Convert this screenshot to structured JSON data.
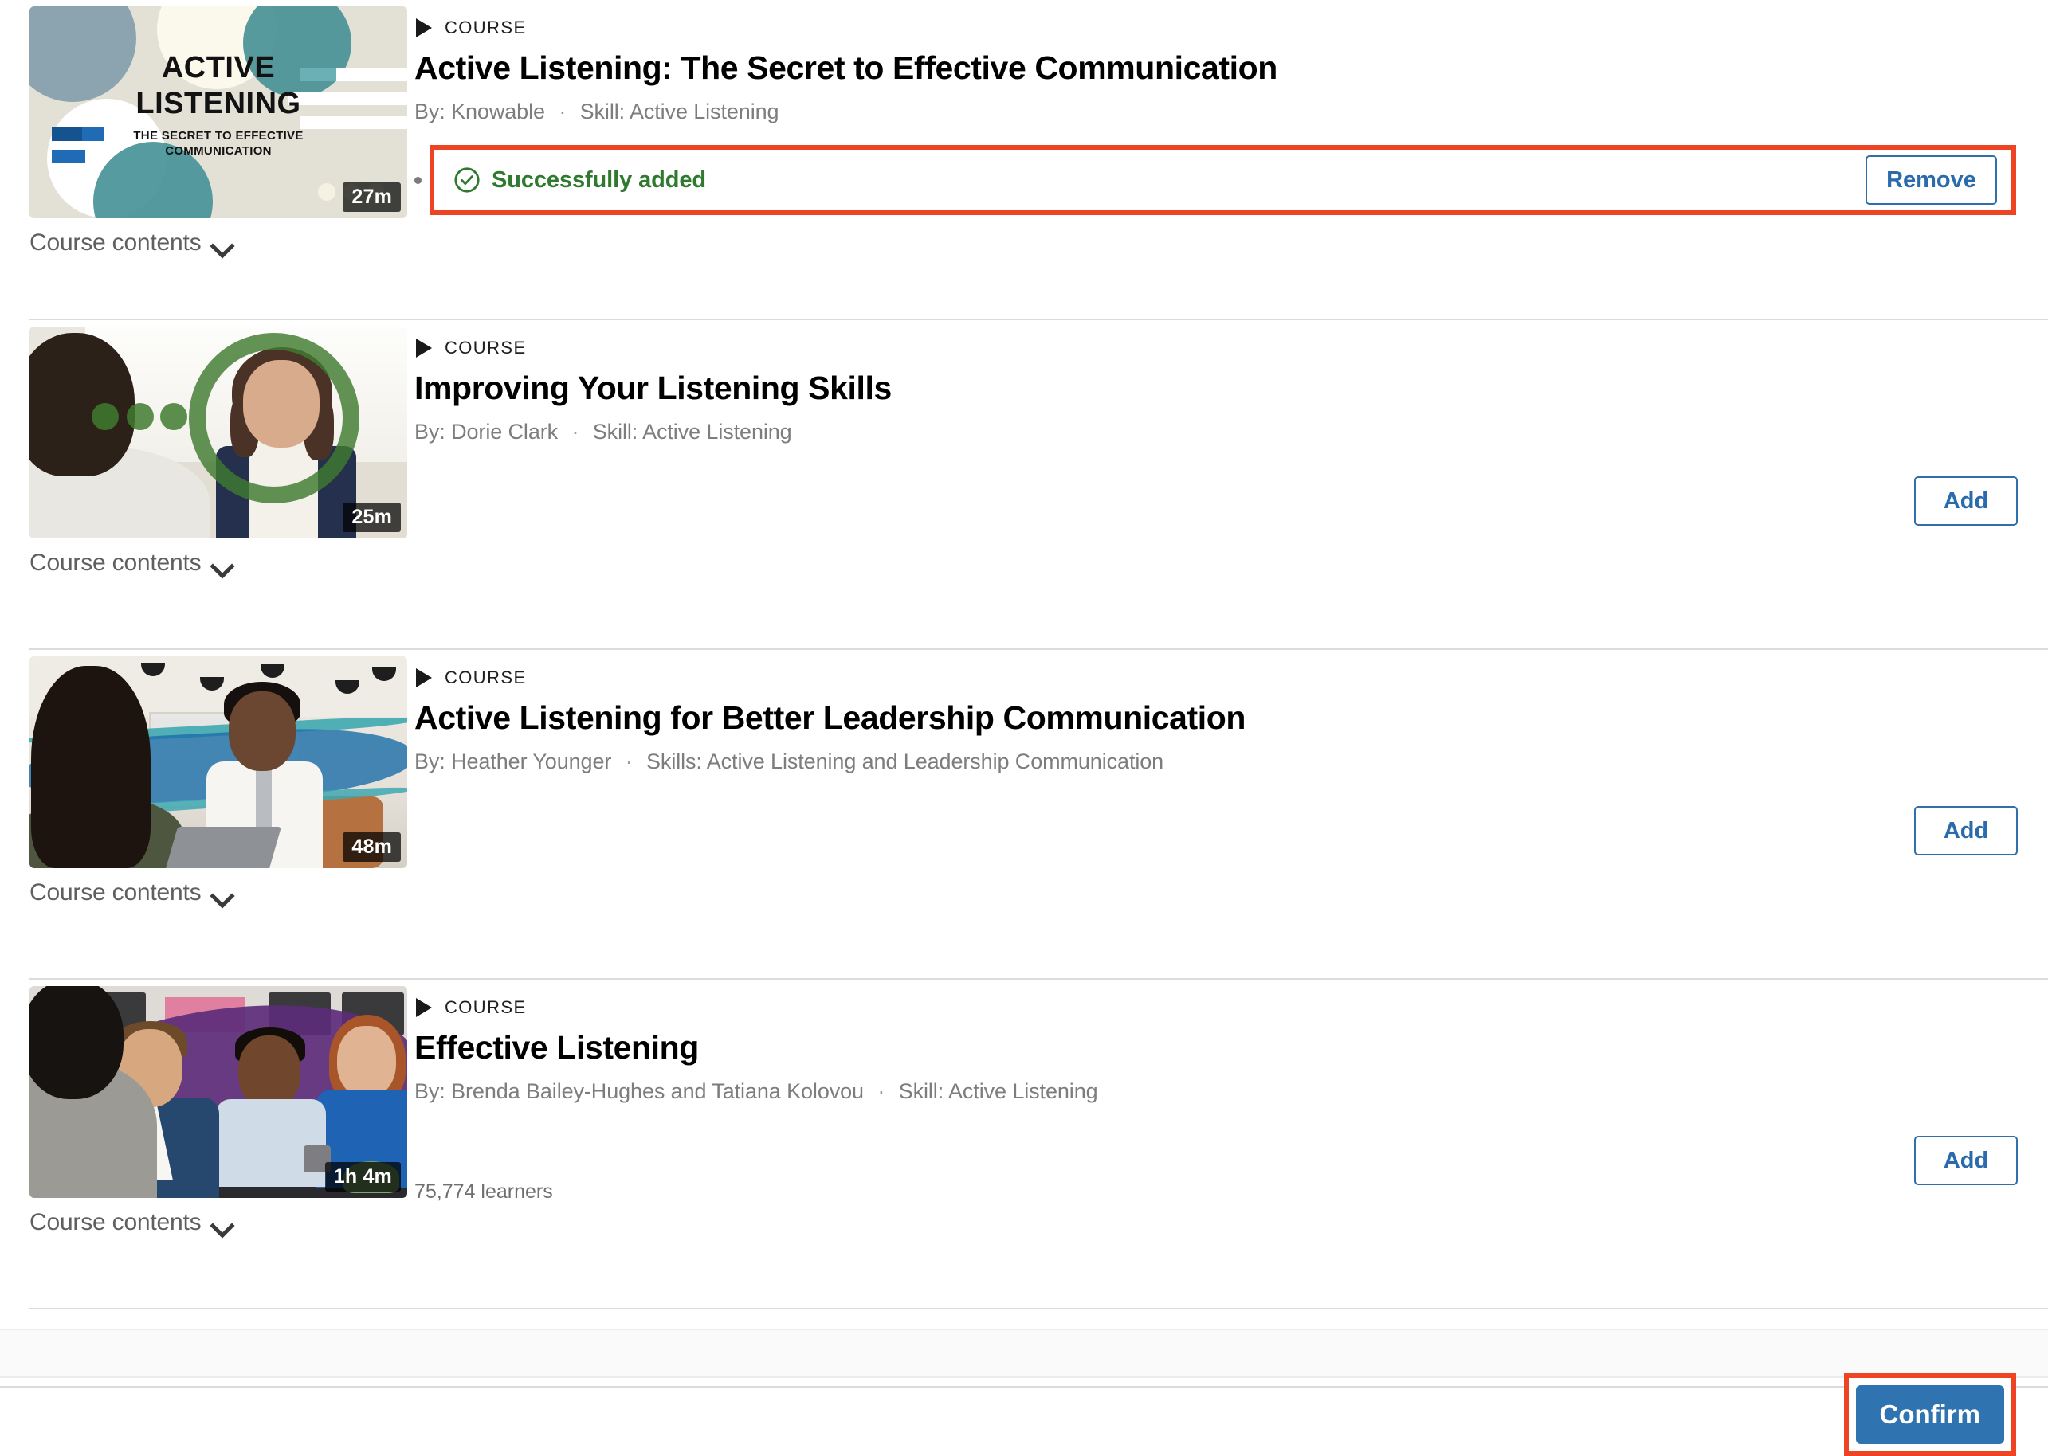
{
  "kicker_label": "COURSE",
  "contents_toggle_label": "Course contents",
  "status": {
    "text": "Successfully added",
    "icon": "check-circle-icon",
    "color": "#2f7a2f",
    "highlight_color": "#ef4423"
  },
  "buttons": {
    "add": "Add",
    "remove": "Remove",
    "confirm": "Confirm",
    "outline_color": "#2f6fab",
    "confirm_bg": "#2f73b0"
  },
  "courses": [
    {
      "kicker": "COURSE",
      "title": "Active Listening: The Secret to Effective Communication",
      "byline_author": "By: Knowable",
      "byline_skill": "Skill: Active Listening",
      "duration": "27m",
      "contents_label": "Course contents",
      "state": "added",
      "action_label": "Remove",
      "status_text": "Successfully added",
      "learners": ""
    },
    {
      "kicker": "COURSE",
      "title": "Improving Your Listening Skills",
      "byline_author": "By: Dorie Clark",
      "byline_skill": "Skill: Active Listening",
      "duration": "25m",
      "contents_label": "Course contents",
      "state": "not-added",
      "action_label": "Add",
      "status_text": "",
      "learners": ""
    },
    {
      "kicker": "COURSE",
      "title": "Active Listening for Better Leadership Communication",
      "byline_author": "By: Heather Younger",
      "byline_skill": "Skills: Active Listening and Leadership Communication",
      "duration": "48m",
      "contents_label": "Course contents",
      "state": "not-added",
      "action_label": "Add",
      "status_text": "",
      "learners": ""
    },
    {
      "kicker": "COURSE",
      "title": "Effective Listening",
      "byline_author": "By: Brenda Bailey-Hughes and Tatiana Kolovou",
      "byline_skill": "Skill: Active Listening",
      "duration": "1h 4m",
      "contents_label": "Course contents",
      "state": "not-added",
      "action_label": "Add",
      "status_text": "",
      "learners": "75,774 learners"
    }
  ],
  "thumbnail_1_text": {
    "line1": "ACTIVE",
    "line2": "LISTENING",
    "line3": "THE SECRET TO EFFECTIVE",
    "line4": "COMMUNICATION"
  }
}
